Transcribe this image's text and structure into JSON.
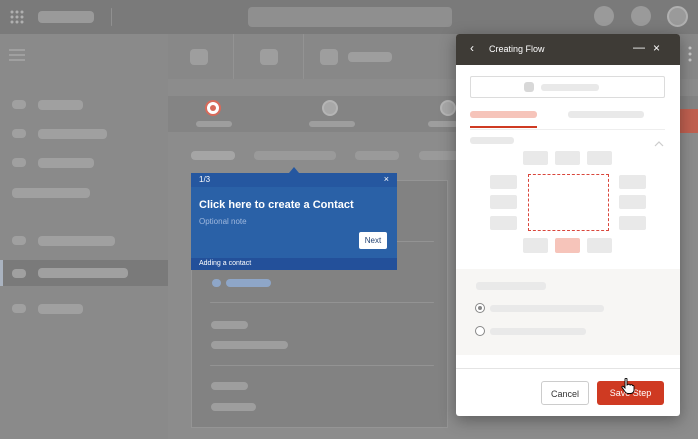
{
  "tooltip": {
    "step": "1/3",
    "close_glyph": "×",
    "title": "Click here to create a Contact",
    "note": "Optional note",
    "next_label": "Next",
    "footer": "Adding a contact"
  },
  "panel": {
    "title": "Creating Flow",
    "back_glyph": "‹",
    "minimize_glyph": "—",
    "close_glyph": "×",
    "cancel_label": "Cancel",
    "save_label": "Save Step"
  },
  "colors": {
    "accent": "#cf3a22",
    "tooltip_blue": "#2a61a7",
    "panel_header": "#3e3b36"
  }
}
